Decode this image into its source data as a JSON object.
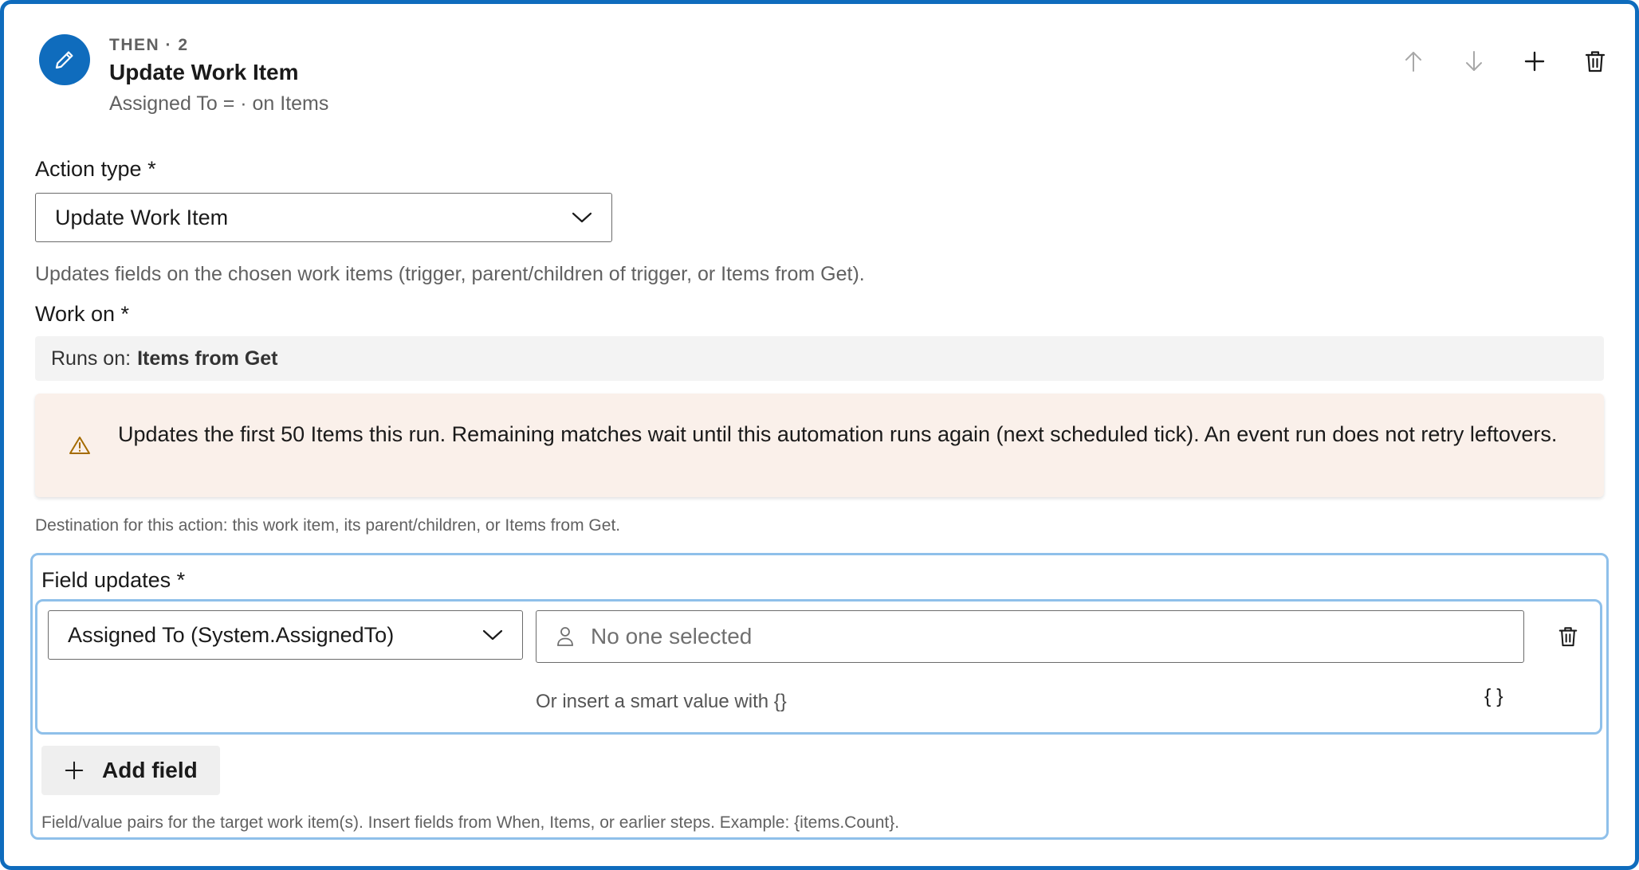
{
  "header": {
    "eyebrow": "THEN · 2",
    "title": "Update Work Item",
    "subtitle": "Assigned To = · on Items"
  },
  "toolbar": {
    "move_up_icon": "arrow-up-icon",
    "move_down_icon": "arrow-down-icon",
    "add_icon": "plus-icon",
    "delete_icon": "trash-icon"
  },
  "action_type": {
    "label": "Action type *",
    "selected": "Update Work Item",
    "hint": "Updates fields on the chosen work items (trigger, parent/children of trigger, or Items from Get)."
  },
  "work_on": {
    "label": "Work on *",
    "runs_on_prefix": "Runs on:",
    "runs_on_value": "Items from Get",
    "warning": "Updates the first 50 Items this run. Remaining matches wait until this automation runs again (next scheduled tick). An event run does not retry leftovers.",
    "hint": "Destination for this action: this work item, its parent/children, or Items from Get."
  },
  "field_updates": {
    "label": "Field updates *",
    "rows": [
      {
        "field": "Assigned To (System.AssignedTo)",
        "value_placeholder": "No one selected",
        "smart_value_hint": "Or insert a smart value with {}",
        "smart_value_button": "{ }"
      }
    ],
    "add_field_label": "Add field",
    "hint": "Field/value pairs for the target work item(s). Insert fields from When, Items, or earlier steps. Example: {items.Count}."
  },
  "colors": {
    "accent": "#0f6cbd",
    "focus_border": "#8fc0ea",
    "warning_bg": "#faf0ea",
    "warning_icon": "#a56b00"
  }
}
